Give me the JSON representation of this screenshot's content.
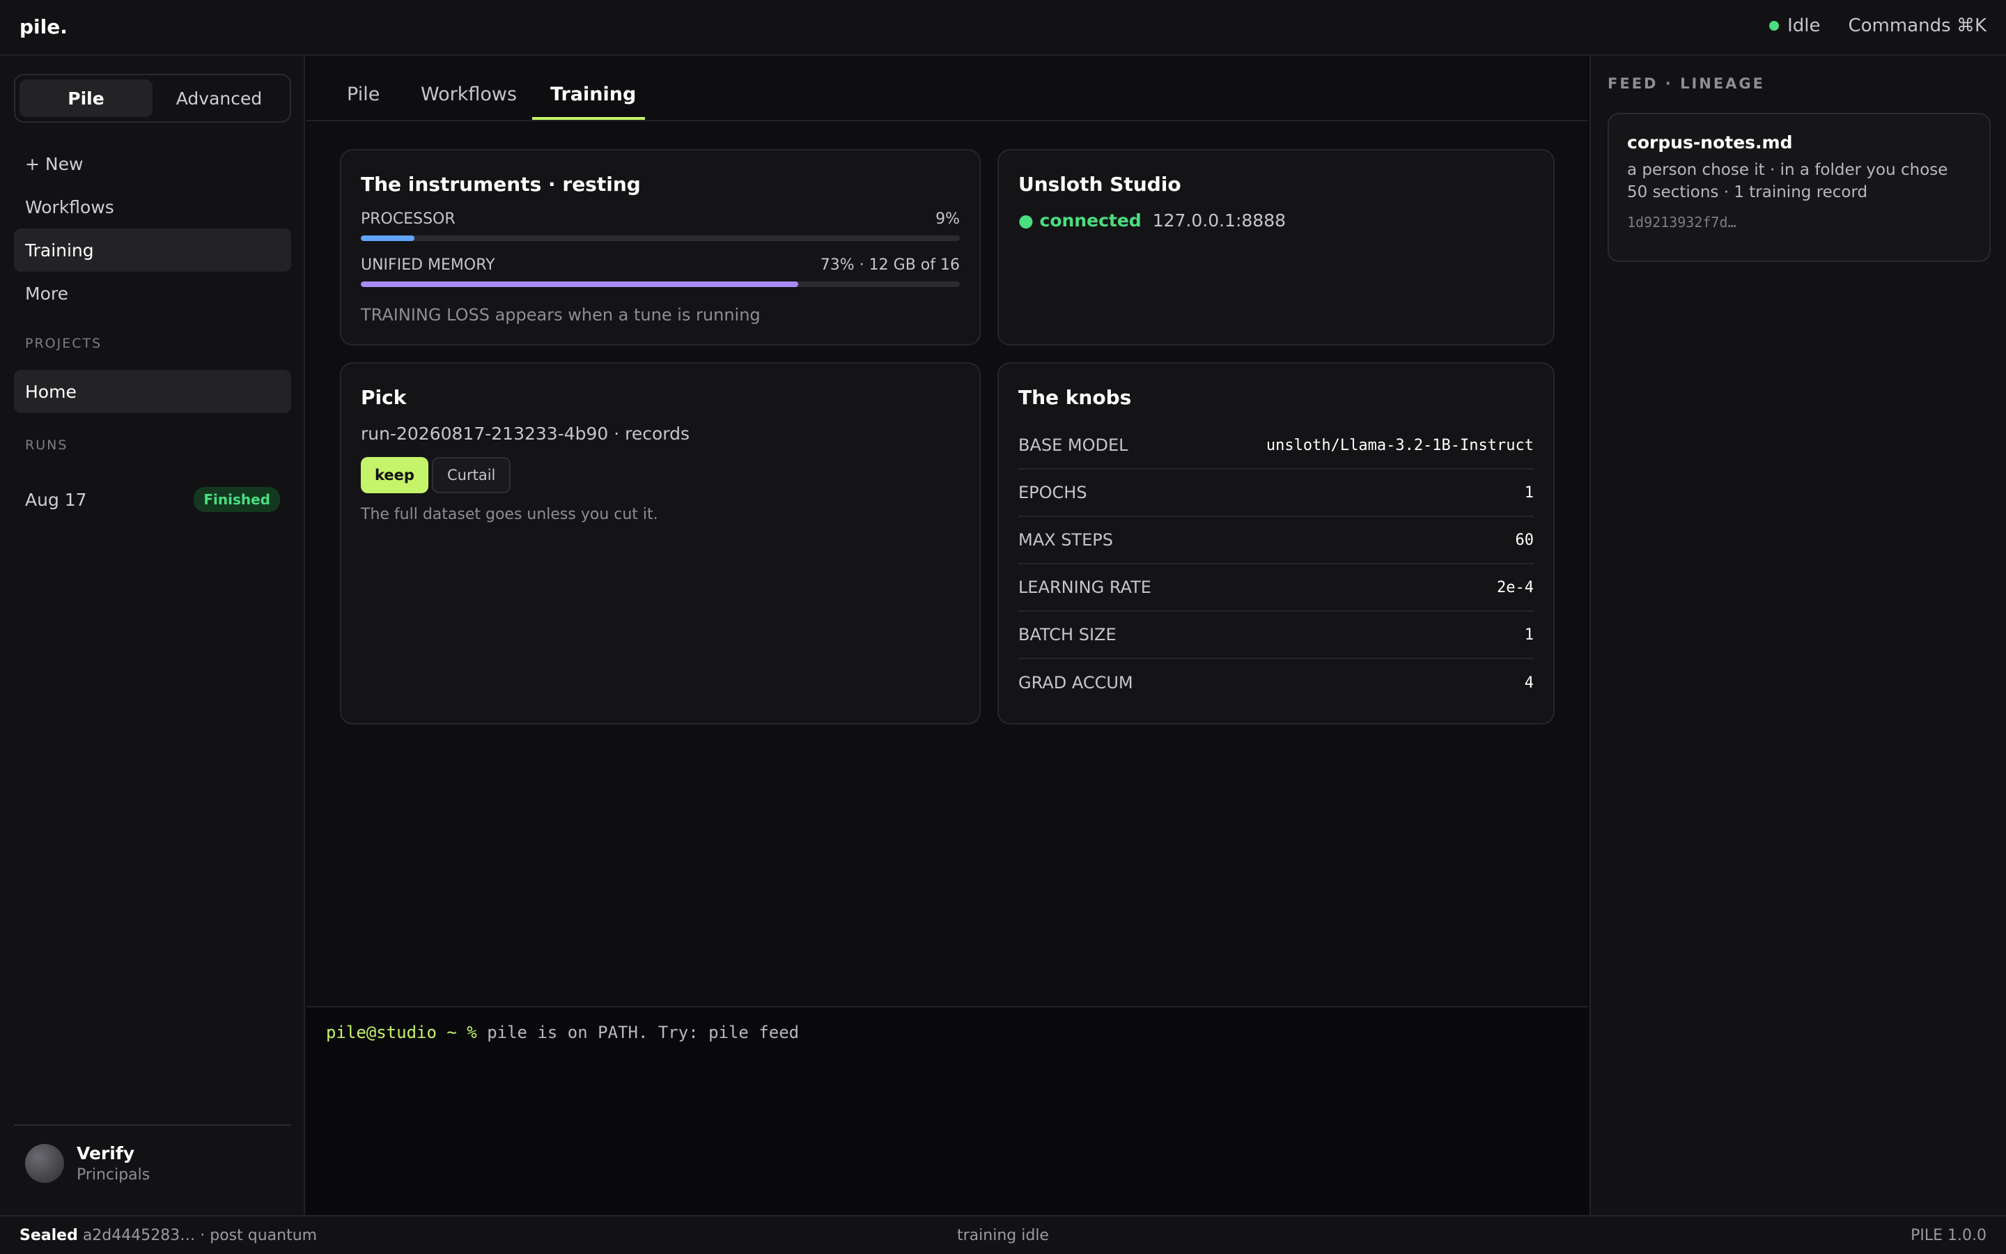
{
  "app": {
    "logo": "pile."
  },
  "topbar": {
    "status_label": "Idle",
    "status_color": "#4ade80",
    "commands_label": "Commands ⌘K"
  },
  "sidebar": {
    "modes": [
      "Pile",
      "Advanced"
    ],
    "active_mode": "Pile",
    "nav": [
      "+ New",
      "Workflows",
      "Training",
      "More"
    ],
    "active_nav": "Training",
    "projects_label": "PROJECTS",
    "projects": [
      "Home"
    ],
    "runs_label": "RUNS",
    "runs": [
      {
        "label": "Aug 17",
        "status": "Finished"
      }
    ],
    "user": {
      "name": "Verify",
      "role": "Principals"
    }
  },
  "tabs": {
    "items": [
      "Pile",
      "Workflows",
      "Training"
    ],
    "active": "Training"
  },
  "instruments": {
    "title": "The instruments · resting",
    "processor": {
      "label": "PROCESSOR",
      "value_text": "9%",
      "fraction": 0.09,
      "color": "#60a5fa"
    },
    "memory": {
      "label": "UNIFIED MEMORY",
      "value_text": "73% · 12 GB of 16",
      "fraction": 0.73,
      "color": "#a78bfa"
    },
    "note": "TRAINING LOSS appears when a tune is running"
  },
  "unsloth": {
    "title": "Unsloth Studio",
    "status": "● connected",
    "status_color": "#4ade80",
    "address": "127.0.0.1:8888"
  },
  "pick": {
    "title": "Pick",
    "run": "run-20260817-213233-4b90 · records",
    "keep_label": "keep",
    "curtail_label": "Curtail",
    "note": "The full dataset goes unless you cut it."
  },
  "knobs": {
    "title": "The knobs",
    "rows": [
      {
        "label": "BASE MODEL",
        "value": "unsloth/Llama-3.2-1B-Instruct"
      },
      {
        "label": "EPOCHS",
        "value": "1"
      },
      {
        "label": "MAX STEPS",
        "value": "60"
      },
      {
        "label": "LEARNING RATE",
        "value": "2e-4"
      },
      {
        "label": "BATCH SIZE",
        "value": "1"
      },
      {
        "label": "GRAD ACCUM",
        "value": "4"
      }
    ]
  },
  "terminal": {
    "prompt": "pile@studio ~ %",
    "text": "pile is on PATH. Try: pile feed"
  },
  "feed": {
    "label": "FEED · LINEAGE",
    "title": "corpus-notes.md",
    "line1": "a person chose it · in a folder you chose",
    "line2": "50 sections · 1 training record",
    "hash": "1d9213932f7d…"
  },
  "statusbar": {
    "sealed": "Sealed",
    "seal_hash": "a2d4445283… · post quantum",
    "center": "training idle",
    "version": "PILE 1.0.0"
  },
  "accent": "#c5f36a"
}
